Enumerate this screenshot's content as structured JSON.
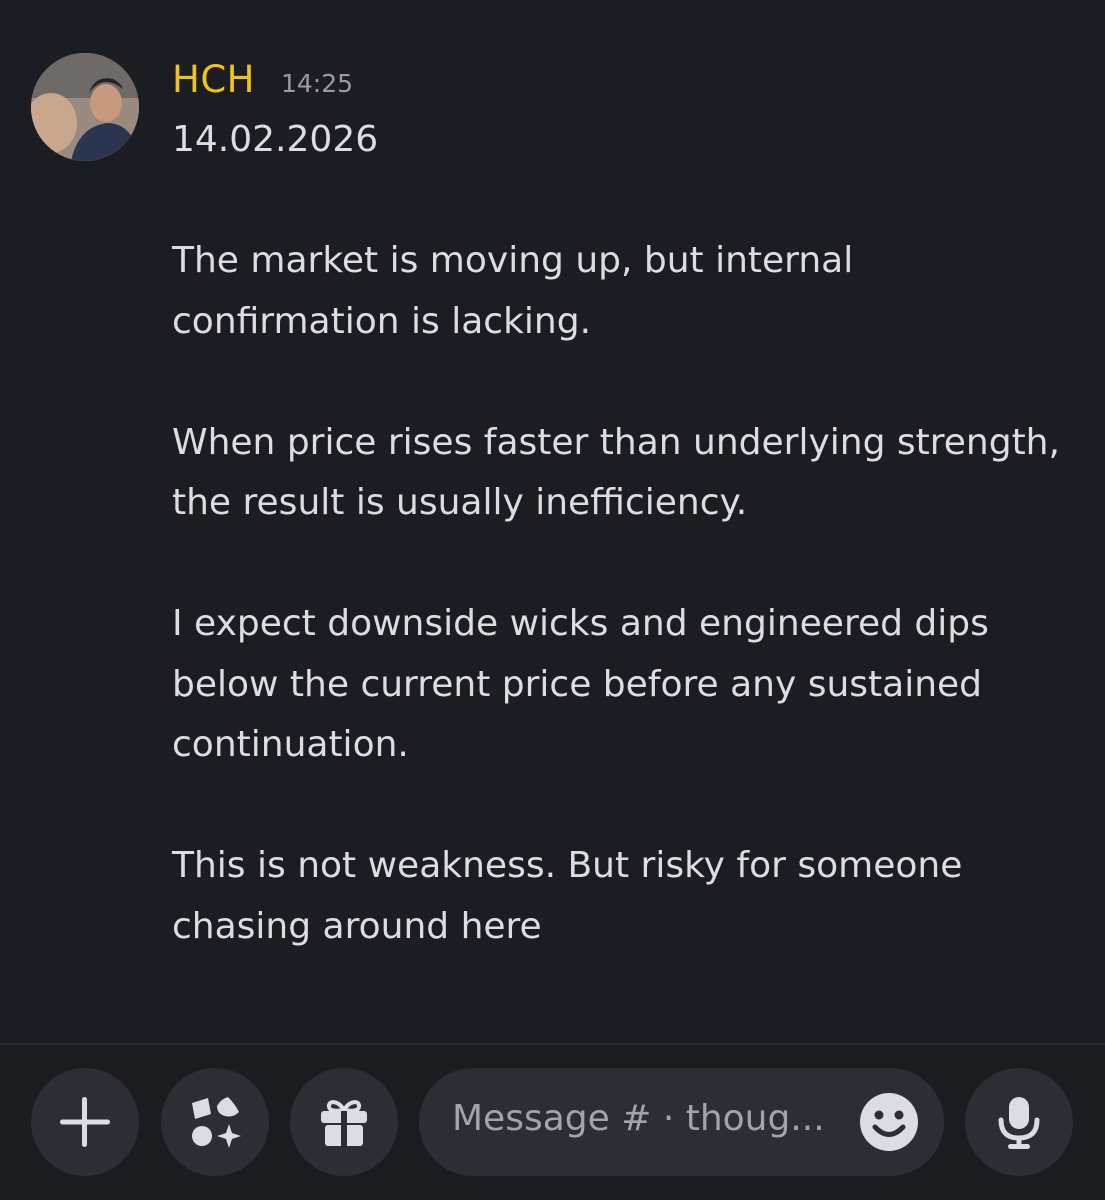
{
  "message": {
    "author": "HCH",
    "timestamp": "14:25",
    "lines": [
      "14.02.2026",
      "",
      "The market is moving up, but internal",
      "confirmation is lacking.",
      "",
      "When price rises faster than underlying strength,",
      "the result is usually inefficiency.",
      "",
      "I expect downside wicks and engineered dips",
      "below the current price before any sustained",
      "continuation.",
      "",
      "This is not weakness. But risky for  someone",
      "chasing around here"
    ]
  },
  "composer": {
    "placeholder": "Message # · thoug...",
    "buttons": {
      "add": "plus-icon",
      "apps": "apps-icon",
      "gift": "gift-icon",
      "emoji": "smiley-icon",
      "voice": "microphone-icon"
    }
  },
  "colors": {
    "background": "#1c1d22",
    "username": "#f0c316",
    "text": "#dcdde2",
    "muted": "#9a9ba3",
    "button_bg": "#2d2e35"
  }
}
